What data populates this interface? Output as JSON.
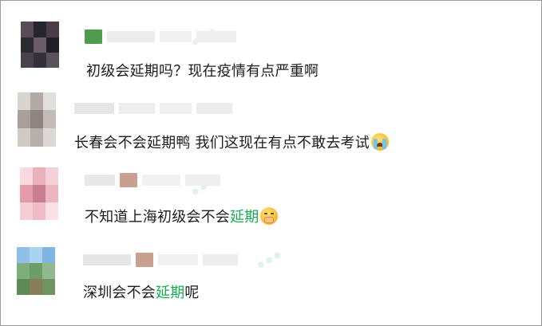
{
  "comments": [
    {
      "text": "初级会延期吗？现在疫情有点严重啊"
    },
    {
      "text": "长春会不会延期鸭 我们这现在有点不敢去考试",
      "emoji": "crying-face-emoji"
    },
    {
      "text_before": "不知道上海初级会不会",
      "keyword": "延期",
      "emoji": "shushing-face-emoji"
    },
    {
      "text_before": "深圳会不会",
      "keyword": "延期",
      "text_after": "呢"
    }
  ],
  "colors": {
    "keyword": "#1aab52",
    "text": "#1c1c1c",
    "border": "#9a9a9a"
  }
}
